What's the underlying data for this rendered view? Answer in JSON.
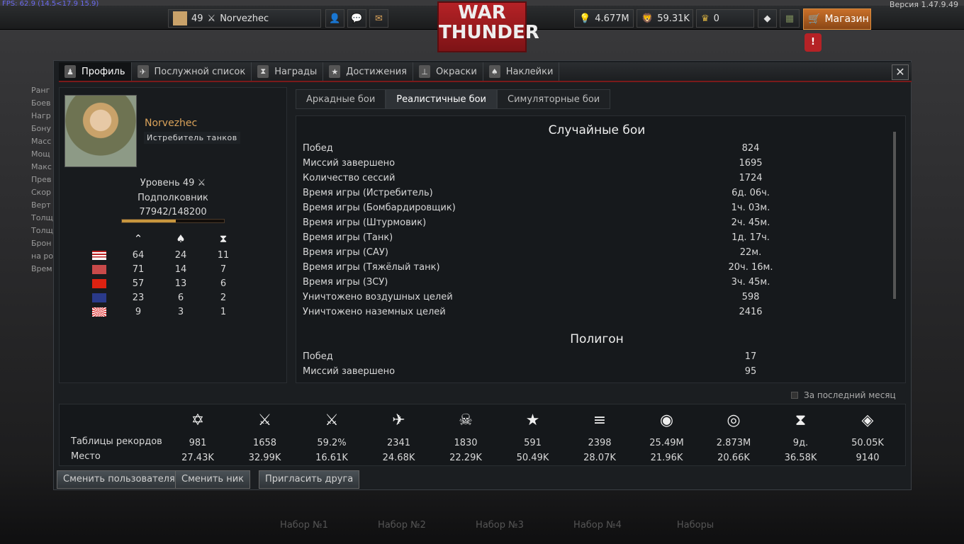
{
  "fps": "FPS: 62.9 (14.5<17.9 15.9)",
  "version": "Версия 1.47.9.49",
  "topbar": {
    "level": "49",
    "nickname": "Norvezhec",
    "logo_line1": "WAR",
    "logo_line2": "THUNDER",
    "research_points": "4.677M",
    "silver_lions": "59.31K",
    "golden_eagles": "0",
    "shop_label": "Магазин"
  },
  "tabs": [
    {
      "label": "Профиль",
      "icon": "user-icon"
    },
    {
      "label": "Послужной список",
      "icon": "plane-icon"
    },
    {
      "label": "Награды",
      "icon": "medal-icon"
    },
    {
      "label": "Достижения",
      "icon": "star-icon"
    },
    {
      "label": "Окраски",
      "icon": "paint-icon"
    },
    {
      "label": "Наклейки",
      "icon": "spade-icon"
    }
  ],
  "profile": {
    "name": "Norvezhec",
    "title": "Истребитель танков",
    "level": "Уровень 49",
    "rank": "Подполковник",
    "exp": "77942/148200",
    "exp_progress": 0.526,
    "nation_headers": [
      "vehicles-icon",
      "spade-icon",
      "medal-icon"
    ],
    "nations": [
      {
        "flag": "usa",
        "values": [
          "64",
          "24",
          "11"
        ]
      },
      {
        "flag": "germany",
        "values": [
          "71",
          "14",
          "7"
        ]
      },
      {
        "flag": "ussr",
        "values": [
          "57",
          "13",
          "6"
        ]
      },
      {
        "flag": "britain",
        "values": [
          "23",
          "6",
          "2"
        ]
      },
      {
        "flag": "japan",
        "values": [
          "9",
          "3",
          "1"
        ]
      }
    ]
  },
  "modes": [
    {
      "label": "Аркадные бои",
      "active": false
    },
    {
      "label": "Реалистичные бои",
      "active": true
    },
    {
      "label": "Симуляторные бои",
      "active": false
    }
  ],
  "stats": {
    "section1": "Случайные бои",
    "rows1": [
      [
        "Побед",
        "824"
      ],
      [
        "Миссий завершено",
        "1695"
      ],
      [
        "Количество сессий",
        "1724"
      ],
      [
        "Время игры (Истребитель)",
        "6д. 06ч."
      ],
      [
        "Время игры (Бомбардировщик)",
        "1ч. 03м."
      ],
      [
        "Время игры (Штурмовик)",
        "2ч. 45м."
      ],
      [
        "Время игры (Танк)",
        "1д. 17ч."
      ],
      [
        "Время игры (САУ)",
        "22м."
      ],
      [
        "Время игры (Тяжёлый танк)",
        "20ч. 16м."
      ],
      [
        "Время игры (ЗСУ)",
        "3ч. 45м."
      ],
      [
        "Уничтожено воздушных целей",
        "598"
      ],
      [
        "Уничтожено наземных целей",
        "2416"
      ]
    ],
    "section2": "Полигон",
    "rows2": [
      [
        "Побед",
        "17"
      ],
      [
        "Миссий завершено",
        "95"
      ]
    ]
  },
  "last_month_label": "За последний месяц",
  "records": {
    "row1_label": "Таблицы рекордов",
    "row2_label": "Место",
    "cols": [
      {
        "icon": "star-badge-icon",
        "value": "981",
        "place": "27.43K"
      },
      {
        "icon": "crossed-swords-icon",
        "value": "1658",
        "place": "32.99K"
      },
      {
        "icon": "swords-star-icon",
        "value": "59.2%",
        "place": "16.61K"
      },
      {
        "icon": "plane-kill-icon",
        "value": "2341",
        "place": "24.68K"
      },
      {
        "icon": "skull-icon",
        "value": "1830",
        "place": "22.29K"
      },
      {
        "icon": "stars-icon",
        "value": "591",
        "place": "50.49K"
      },
      {
        "icon": "tanks-icon",
        "value": "2398",
        "place": "28.07K"
      },
      {
        "icon": "lion-icon",
        "value": "25.49M",
        "place": "21.96K"
      },
      {
        "icon": "bulb-icon",
        "value": "2.873M",
        "place": "20.66K"
      },
      {
        "icon": "hourglass-icon",
        "value": "9д.",
        "place": "36.58K"
      },
      {
        "icon": "diamond-icon",
        "value": "50.05K",
        "place": "9140"
      }
    ]
  },
  "buttons": {
    "switch_user": "Сменить пользователя",
    "change_nick": "Сменить ник",
    "invite_friend": "Пригласить друга"
  },
  "background": {
    "presets": [
      "Набор №1",
      "Набор №2",
      "Набор №3",
      "Набор №4",
      "Наборы"
    ],
    "left_items": [
      "Ранг",
      "Боев",
      "Нагр",
      "Бону",
      "Масс",
      "Мощ",
      "Макс",
      "Прев",
      "Скор",
      "Верт",
      "Толщ",
      "Толщ",
      "Брон",
      "на ро",
      "Врем"
    ]
  },
  "colors": {
    "accent_red": "#b52226",
    "shop_orange": "#c8702a",
    "name_gold": "#d9a25a",
    "exp_bar": "#c8963e"
  }
}
